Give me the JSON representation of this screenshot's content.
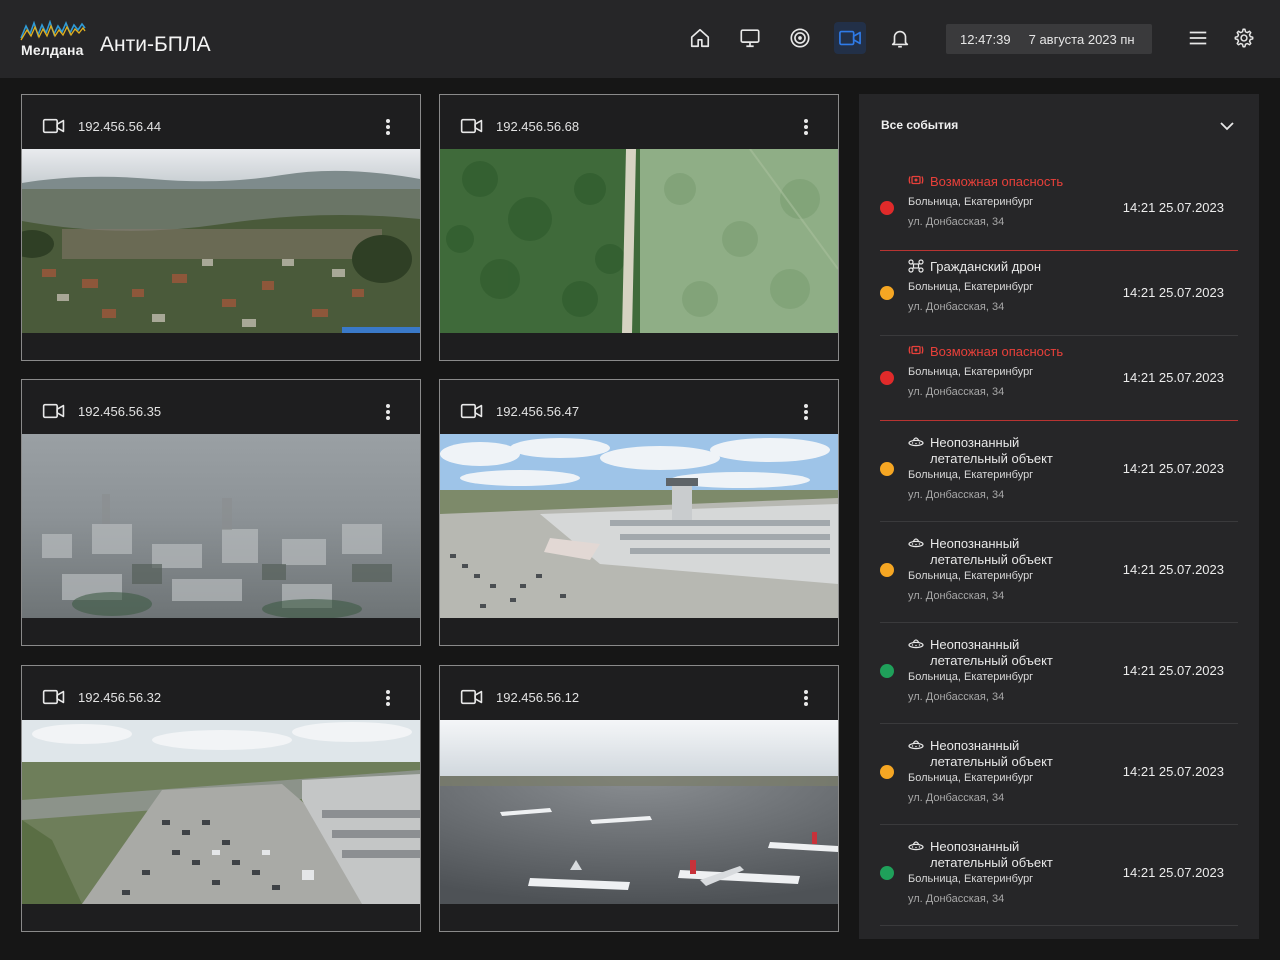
{
  "header": {
    "logo_text": "Мелдана",
    "app_title": "Анти-БПЛА",
    "nav": [
      {
        "name": "home-icon",
        "active": false
      },
      {
        "name": "monitor-icon",
        "active": false
      },
      {
        "name": "target-icon",
        "active": false
      },
      {
        "name": "camera-icon",
        "active": true
      },
      {
        "name": "bell-icon",
        "active": false
      }
    ],
    "time": "12:47:39",
    "date": "7 августа 2023 пн",
    "menu_icon": "hamburger-menu-icon",
    "settings_icon": "gear-icon"
  },
  "cameras": [
    {
      "ip": "192.456.56.44",
      "scene": "village-aerial"
    },
    {
      "ip": "192.456.56.68",
      "scene": "forest-road"
    },
    {
      "ip": "192.456.56.35",
      "scene": "city-haze"
    },
    {
      "ip": "192.456.56.47",
      "scene": "airport-terminal"
    },
    {
      "ip": "192.456.56.32",
      "scene": "parking-lot"
    },
    {
      "ip": "192.456.56.12",
      "scene": "airfield-planes"
    }
  ],
  "events_panel": {
    "title": "Все события",
    "colors": {
      "danger": "#e02a2a",
      "warning": "#f5a623",
      "ok": "#1fa05a"
    },
    "items": [
      {
        "type": "Возможная опасность",
        "type_line2": "",
        "level": "danger",
        "icon": "danger-signal-icon",
        "location": "Больница, Екатеринбург",
        "address": "ул. Донбасская, 34",
        "time": "14:21 25.07.2023"
      },
      {
        "type": "Гражданский дрон",
        "type_line2": "",
        "level": "warning",
        "icon": "drone-icon",
        "location": "Больница, Екатеринбург",
        "address": "ул. Донбасская, 34",
        "time": "14:21 25.07.2023"
      },
      {
        "type": "Возможная опасность",
        "type_line2": "",
        "level": "danger",
        "icon": "danger-signal-icon",
        "location": "Больница, Екатеринбург",
        "address": "ул. Донбасская, 34",
        "time": "14:21 25.07.2023"
      },
      {
        "type": "Неопознанный",
        "type_line2": "летательный объект",
        "level": "warning",
        "icon": "ufo-icon",
        "location": "Больница, Екатеринбург",
        "address": "ул. Донбасская, 34",
        "time": "14:21 25.07.2023"
      },
      {
        "type": "Неопознанный",
        "type_line2": "летательный объект",
        "level": "warning",
        "icon": "ufo-icon",
        "location": "Больница, Екатеринбург",
        "address": "ул. Донбасская, 34",
        "time": "14:21 25.07.2023"
      },
      {
        "type": "Неопознанный",
        "type_line2": "летательный объект",
        "level": "ok",
        "icon": "ufo-icon",
        "location": "Больница, Екатеринбург",
        "address": "ул. Донбасская, 34",
        "time": "14:21 25.07.2023"
      },
      {
        "type": "Неопознанный",
        "type_line2": "летательный объект",
        "level": "warning",
        "icon": "ufo-icon",
        "location": "Больница, Екатеринбург",
        "address": "ул. Донбасская, 34",
        "time": "14:21 25.07.2023"
      },
      {
        "type": "Неопознанный",
        "type_line2": "летательный объект",
        "level": "ok",
        "icon": "ufo-icon",
        "location": "Больница, Екатеринбург",
        "address": "ул. Донбасская, 34",
        "time": "14:21 25.07.2023"
      }
    ]
  }
}
